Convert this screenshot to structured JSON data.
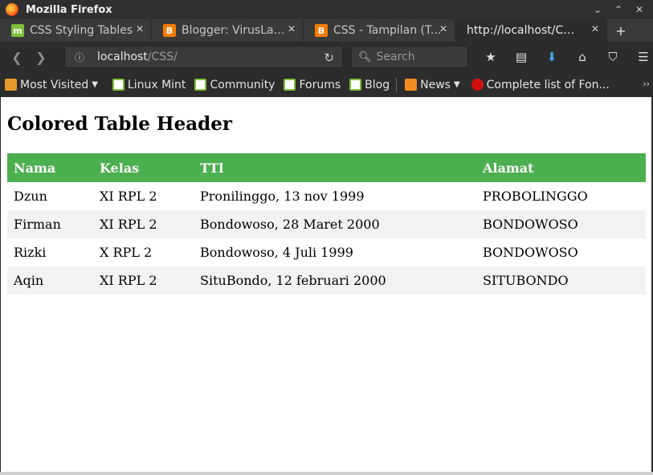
{
  "window": {
    "title": "Mozilla Firefox",
    "controls": [
      "⌄",
      "⌃",
      "✕"
    ]
  },
  "tabs": [
    {
      "label": "CSS Styling Tables",
      "icon": "linux-mint-icon",
      "active": false
    },
    {
      "label": "Blogger: VirusLap...",
      "icon": "blogger-icon",
      "active": false
    },
    {
      "label": "CSS - Tampilan (T...",
      "icon": "blogger-icon",
      "active": false
    },
    {
      "label": "http://localhost/CSS/",
      "icon": "",
      "active": true
    }
  ],
  "navbar": {
    "url_host": "localhost",
    "url_path": "/CSS/",
    "search_placeholder": "Search"
  },
  "bookmarks": [
    {
      "label": "Most Visited",
      "icon": "folder-icon",
      "dropdown": true
    },
    {
      "label": "Linux Mint",
      "icon": "linux-mint-icon"
    },
    {
      "label": "Community",
      "icon": "linux-mint-icon"
    },
    {
      "label": "Forums",
      "icon": "linux-mint-icon"
    },
    {
      "label": "Blog",
      "icon": "linux-mint-icon"
    },
    {
      "label": "News",
      "icon": "rss-icon",
      "dropdown": true
    },
    {
      "label": "Complete list of Fon...",
      "icon": "red-circle-icon"
    }
  ],
  "page": {
    "heading": "Colored Table Header",
    "header_color": "#4caf50",
    "stripe_color": "#f2f2f2",
    "columns": [
      "Nama",
      "Kelas",
      "TTl",
      "Alamat"
    ],
    "rows": [
      [
        "Dzun",
        "XI RPL 2",
        "Pronilinggo, 13 nov 1999",
        "PROBOLINGGO"
      ],
      [
        "Firman",
        "XI RPL 2",
        "Bondowoso, 28 Maret 2000",
        "BONDOWOSO"
      ],
      [
        "Rizki",
        "X RPL 2",
        "Bondowoso, 4 Juli 1999",
        "BONDOWOSO"
      ],
      [
        "Aqin",
        "XI RPL 2",
        "SituBondo, 12 februari 2000",
        "SITUBONDO"
      ]
    ]
  }
}
